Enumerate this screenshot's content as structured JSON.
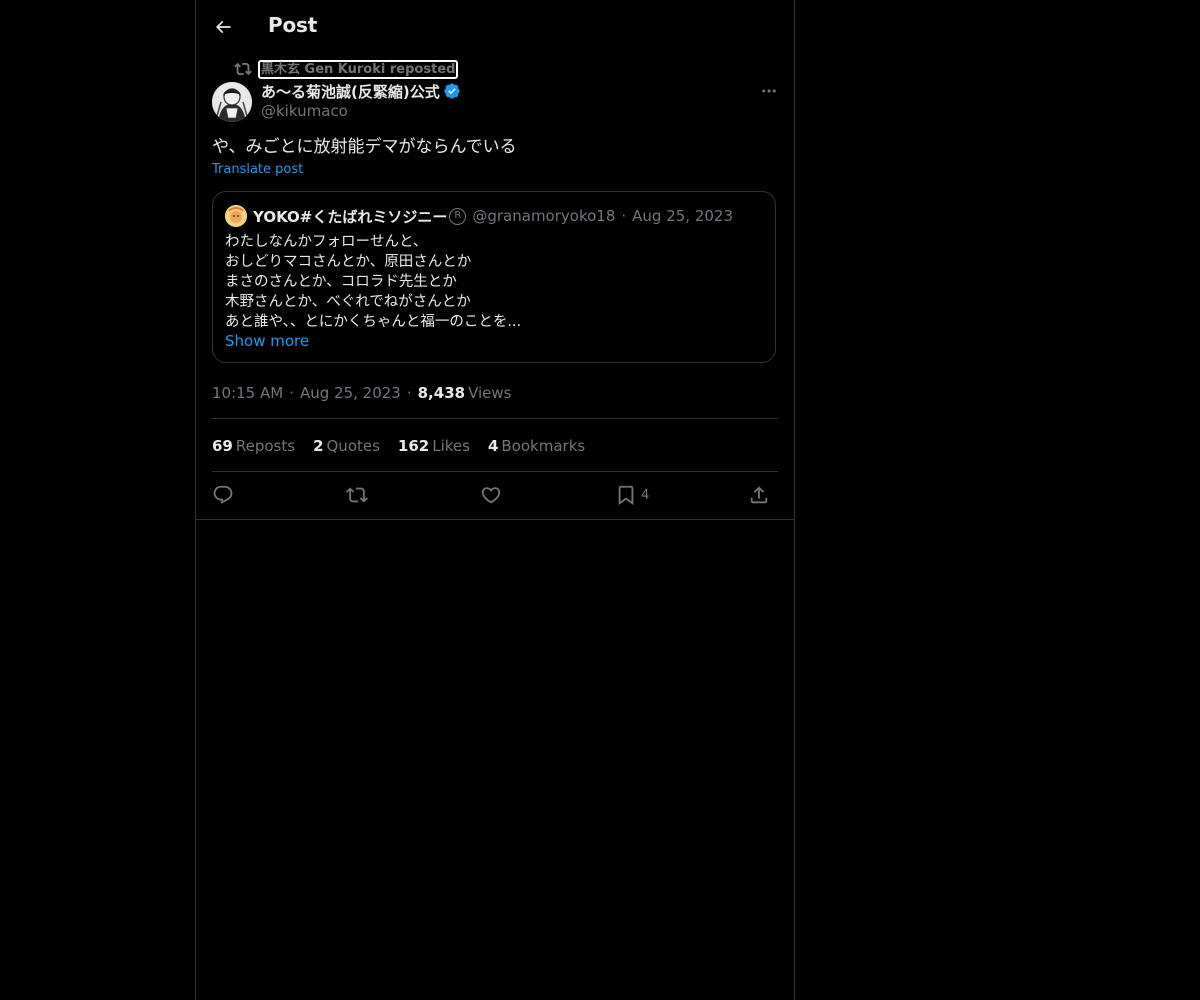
{
  "header": {
    "title": "Post",
    "back_icon": "back-arrow-icon"
  },
  "repost": {
    "label": "黒木玄 Gen Kuroki reposted",
    "icon": "repost-icon"
  },
  "post": {
    "author_name": "あ〜る菊池誠(反緊縮)公式",
    "author_handle": "@kikumaco",
    "verified": true,
    "text": "や、みごとに放射能デマがならんでいる",
    "translate_label": "Translate post",
    "time": "10:15 AM",
    "date": "Aug 25, 2023",
    "views_count": "8,438",
    "views_label": "Views"
  },
  "quote": {
    "name": "YOKO#くたばれミソジニー",
    "reg_mark": "R",
    "handle": "@granamoryoko18",
    "date": "Aug 25, 2023",
    "lines": [
      "わたしなんかフォローせんと、",
      "おしどりマコさんとか、原田さんとか",
      "まさのさんとか、コロラド先生とか",
      "木野さんとか、べぐれでねがさんとか",
      "あと誰や、、とにかくちゃんと福一のことを..."
    ],
    "show_more": "Show more"
  },
  "stats": [
    {
      "count": "69",
      "label": "Reposts"
    },
    {
      "count": "2",
      "label": "Quotes"
    },
    {
      "count": "162",
      "label": "Likes"
    },
    {
      "count": "4",
      "label": "Bookmarks"
    }
  ],
  "actions": {
    "reply_icon": "reply-icon",
    "repost_icon": "repost-icon",
    "like_icon": "heart-icon",
    "bookmark_icon": "bookmark-icon",
    "bookmark_count": "4",
    "share_icon": "share-icon"
  },
  "colors": {
    "background": "#000000",
    "text": "#e7e9ea",
    "muted": "#71767b",
    "accent": "#1d9bf0",
    "border": "#2f3336"
  }
}
